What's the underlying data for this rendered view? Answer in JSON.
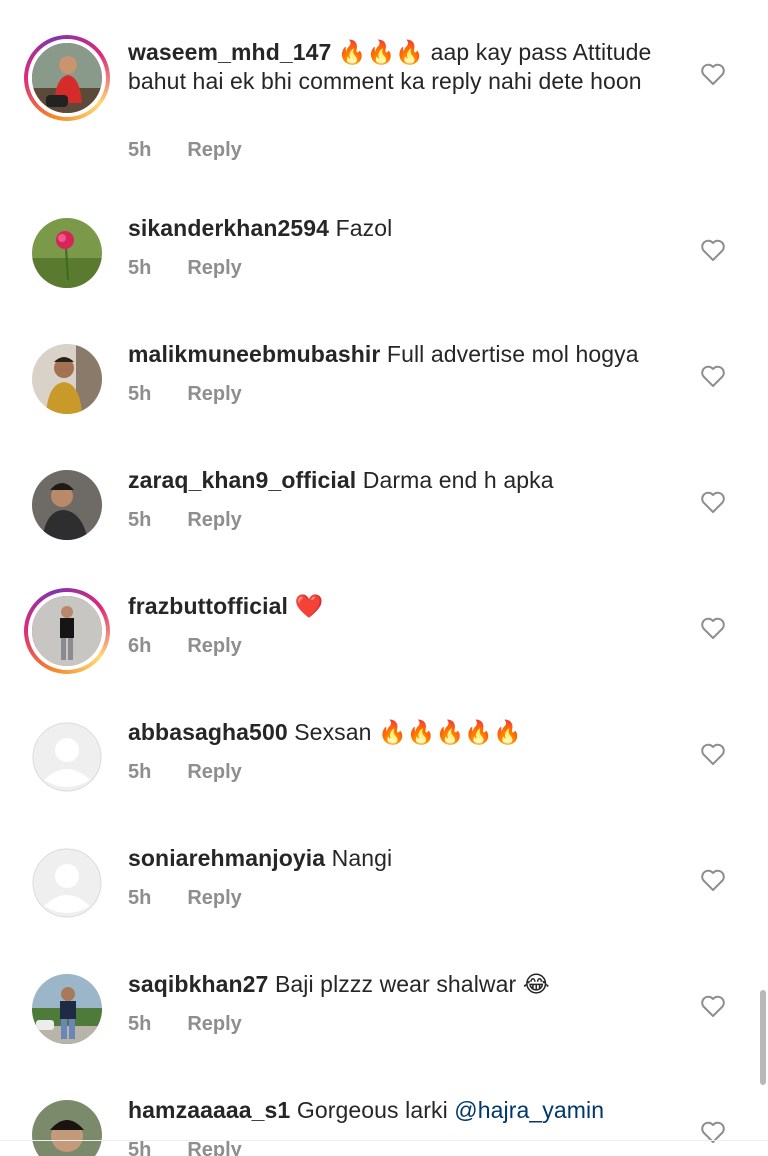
{
  "comments": [
    {
      "username": "waseem_mhd_147",
      "text": "🔥🔥🔥 aap kay pass Attitude bahut hai ek bhi comment ka reply nahi dete hoon",
      "time": "5h",
      "reply_label": "Reply",
      "avatar": "photo-person-red-shirt",
      "story_ring": true
    },
    {
      "username": "sikanderkhan2594",
      "text": "Fazol",
      "time": "5h",
      "reply_label": "Reply",
      "avatar": "photo-rose-flower",
      "story_ring": false
    },
    {
      "username": "malikmuneebmubashir",
      "text": "Full advertise mol hogya",
      "time": "5h",
      "reply_label": "Reply",
      "avatar": "photo-person-yellow-shirt",
      "story_ring": false
    },
    {
      "username": "zaraq_khan9_official",
      "text": "Darma end h apka",
      "time": "5h",
      "reply_label": "Reply",
      "avatar": "photo-person-portrait",
      "story_ring": false
    },
    {
      "username": "frazbuttofficial",
      "text": "❤️",
      "time": "6h",
      "reply_label": "Reply",
      "avatar": "photo-person-standing",
      "story_ring": true
    },
    {
      "username": "abbasagha500",
      "text": "Sexsan 🔥🔥🔥🔥🔥",
      "time": "5h",
      "reply_label": "Reply",
      "avatar": "default-avatar",
      "story_ring": false
    },
    {
      "username": "soniarehmanjoyia",
      "text": "Nangi",
      "time": "5h",
      "reply_label": "Reply",
      "avatar": "default-avatar",
      "story_ring": false
    },
    {
      "username": "saqibkhan27",
      "text": "Baji plzzz wear shalwar 😂",
      "time": "5h",
      "reply_label": "Reply",
      "avatar": "photo-person-outdoors",
      "story_ring": false
    },
    {
      "username": "hamzaaaaa_s1",
      "text": "Gorgeous larki",
      "mention": "@hajra_yamin",
      "time": "5h",
      "reply_label": "Reply",
      "avatar": "photo-person-face",
      "story_ring": false
    }
  ],
  "colors": {
    "text": "#262626",
    "meta": "#8e8e8e",
    "mention": "#00376b"
  },
  "icons": {
    "like": "heart-outline-icon"
  }
}
